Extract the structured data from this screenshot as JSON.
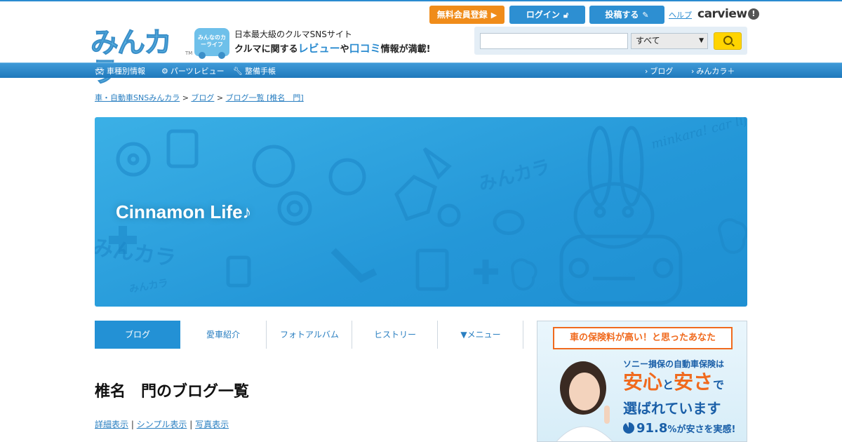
{
  "header": {
    "logo": "みんカラ",
    "logo_tm": "TM",
    "car_badge": "みんなのカーライフ",
    "tagline_top": "日本最大級のクルマSNSサイト",
    "tagline_pre": "クルマに関する",
    "tagline_review": "レビュー",
    "tagline_mid": "や",
    "tagline_kuchikomi": "口コミ",
    "tagline_post": "情報が満載!",
    "register_label": "無料会員登録",
    "login_label": "ログイン",
    "post_label": "投稿する",
    "help_label": "ヘルプ",
    "carview_label": "carview"
  },
  "search": {
    "value": "",
    "placeholder": "",
    "category": "すべて"
  },
  "nav": {
    "items": [
      {
        "label": "車種別情報"
      },
      {
        "label": "パーツレビュー"
      },
      {
        "label": "整備手帳"
      },
      {
        "label": "ブログ"
      },
      {
        "label": "みんカラ＋"
      }
    ]
  },
  "breadcrumb": {
    "items": [
      "車・自動車SNSみんカラ",
      "ブログ",
      "ブログ一覧 [椎名　門]"
    ],
    "sep": ">"
  },
  "banner": {
    "title": "Cinnamon Life♪",
    "scribble": "minkara! car life of car lovers!!"
  },
  "tabs": [
    {
      "label": "ブログ",
      "active": true
    },
    {
      "label": "愛車紹介",
      "active": false
    },
    {
      "label": "フォトアルバム",
      "active": false
    },
    {
      "label": "ヒストリー",
      "active": false
    },
    {
      "label": "▼メニュー",
      "active": false
    }
  ],
  "page": {
    "heading": "椎名　門のブログ一覧",
    "views": [
      "詳細表示",
      "シンプル表示",
      "写真表示"
    ],
    "view_sep": "|"
  },
  "ad": {
    "headline": "車の保険料が高い！と思ったあなた",
    "line1": "ソニー損保の自動車保険は",
    "line2_a": "安心",
    "line2_b": "と",
    "line2_c": "安さ",
    "line2_d": "で",
    "line3": "選ばれています",
    "stat_value": "91.8",
    "stat_unit": "%",
    "stat_text": "が安さを実感!",
    "stat_fraction": 0.918
  },
  "colors": {
    "accent": "#2391d5",
    "register": "#f08c1a",
    "nav": "#2a8bd0",
    "ad_orange": "#f06a1e"
  }
}
